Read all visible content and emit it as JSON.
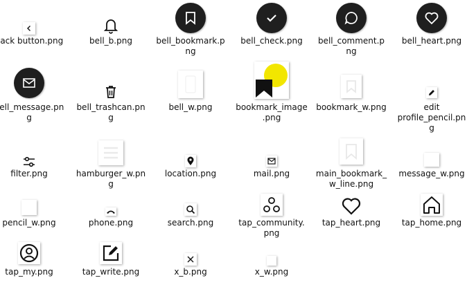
{
  "files": [
    {
      "name": "back button.png",
      "icon": "chevron-left-icon"
    },
    {
      "name": "bell_b.png",
      "icon": "bell-icon"
    },
    {
      "name": "bell_bookmark.png",
      "icon": "bookmark-icon"
    },
    {
      "name": "bell_check.png",
      "icon": "check-icon"
    },
    {
      "name": "bell_comment.png",
      "icon": "comment-icon"
    },
    {
      "name": "bell_heart.png",
      "icon": "heart-icon"
    },
    {
      "name": "bell_message.png",
      "icon": "mail-icon"
    },
    {
      "name": "bell_trashcan.png",
      "icon": "trashcan-icon"
    },
    {
      "name": "bell_w.png",
      "icon": "blank-icon"
    },
    {
      "name": "bookmark_image.png",
      "icon": "bookmark-image-icon"
    },
    {
      "name": "bookmark_w.png",
      "icon": "bookmark-outline-icon"
    },
    {
      "name": "edit profile_pencil.png",
      "icon": "pencil-icon"
    },
    {
      "name": "filter.png",
      "icon": "filter-icon"
    },
    {
      "name": "hamburger_w.png",
      "icon": "hamburger-icon"
    },
    {
      "name": "location.png",
      "icon": "location-icon"
    },
    {
      "name": "mail.png",
      "icon": "mail-icon"
    },
    {
      "name": "main_bookmark_w_line.png",
      "icon": "bookmark-outline-icon"
    },
    {
      "name": "message_w.png",
      "icon": "blank-icon"
    },
    {
      "name": "pencil_w.png",
      "icon": "blank-icon"
    },
    {
      "name": "phone.png",
      "icon": "phone-icon"
    },
    {
      "name": "search.png",
      "icon": "search-icon"
    },
    {
      "name": "tap_community.png",
      "icon": "community-icon"
    },
    {
      "name": "tap_heart.png",
      "icon": "heart-outline-icon"
    },
    {
      "name": "tap_home.png",
      "icon": "home-icon"
    },
    {
      "name": "tap_my.png",
      "icon": "user-icon"
    },
    {
      "name": "tap_write.png",
      "icon": "write-icon"
    },
    {
      "name": "x_b.png",
      "icon": "x-icon"
    },
    {
      "name": "x_w.png",
      "icon": "blank-icon"
    }
  ],
  "labels": [
    "back button.png",
    "bell_b.png",
    "bell_bookmark.p\nng",
    "bell_check.png",
    "bell_comment.p\nng",
    "bell_heart.png",
    "bell_message.pn\ng",
    "bell_trashcan.pn\ng",
    "bell_w.png",
    "bookmark_image\n.png",
    "bookmark_w.png",
    "edit\nprofile_pencil.pn\ng",
    "filter.png",
    "hamburger_w.pn\ng",
    "location.png",
    "mail.png",
    "main_bookmark_\nw_line.png",
    "message_w.png",
    "pencil_w.png",
    "phone.png",
    "search.png",
    "tap_community.\npng",
    "tap_heart.png",
    "tap_home.png",
    "tap_my.png",
    "tap_write.png",
    "x_b.png",
    "x_w.png"
  ],
  "colors": {
    "dark": "#1f1f1f",
    "yellow": "#f2e600",
    "paper": "#ffffff"
  }
}
